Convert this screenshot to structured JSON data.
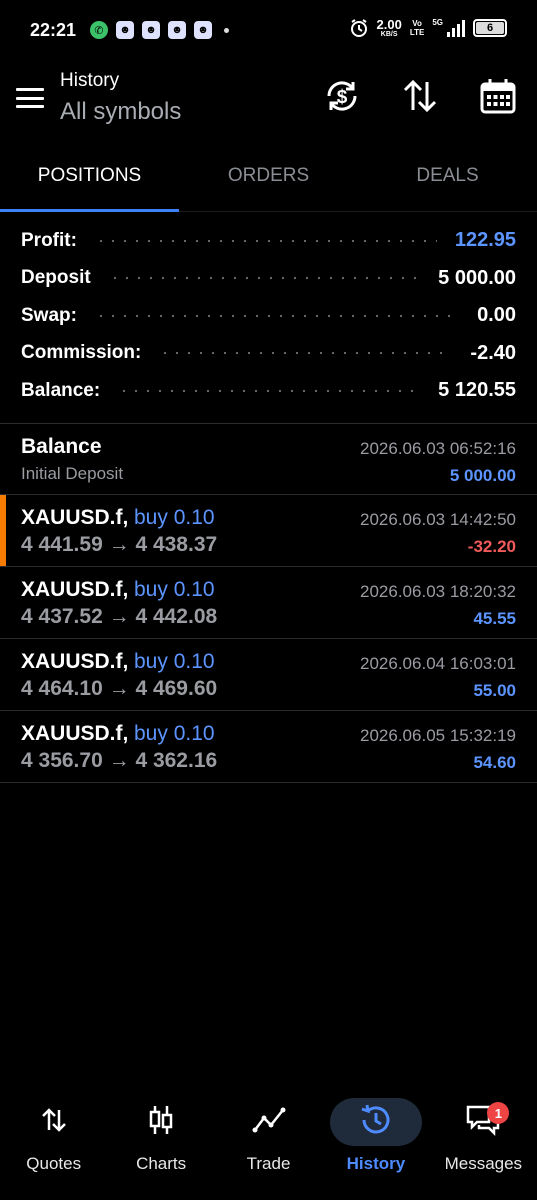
{
  "status_bar": {
    "time": "22:21",
    "speed_value": "2.00",
    "speed_unit": "KB/S",
    "network_label_top": "Vo",
    "network_label_bottom": "LTE",
    "network_type": "5G",
    "battery": "6",
    "apps": [
      "whatsapp-icon",
      "discord-icon",
      "discord-icon",
      "discord-icon",
      "discord-icon"
    ]
  },
  "header": {
    "title": "History",
    "subtitle": "All symbols",
    "icons": [
      "sync-currency-icon",
      "sort-icon",
      "calendar-icon"
    ]
  },
  "tabs": [
    {
      "label": "POSITIONS",
      "active": true
    },
    {
      "label": "ORDERS",
      "active": false
    },
    {
      "label": "DEALS",
      "active": false
    }
  ],
  "summary": [
    {
      "label": "Profit:",
      "value": "122.95",
      "highlight": true
    },
    {
      "label": "Deposit",
      "value": "5 000.00",
      "highlight": false
    },
    {
      "label": "Swap:",
      "value": "0.00",
      "highlight": false
    },
    {
      "label": "Commission:",
      "value": "-2.40",
      "highlight": false
    },
    {
      "label": "Balance:",
      "value": "5 120.55",
      "highlight": false
    }
  ],
  "balance_row": {
    "title": "Balance",
    "subtitle": "Initial Deposit",
    "date": "2026.06.03 06:52:16",
    "amount": "5 000.00"
  },
  "positions": [
    {
      "symbol": "XAUUSD.f,",
      "type": "buy 0.10",
      "open_price": "4 441.59",
      "arrow": "→",
      "close_price": "4 438.37",
      "date": "2026.06.03 14:42:50",
      "profit": "-32.20",
      "negative": true,
      "marked": true
    },
    {
      "symbol": "XAUUSD.f,",
      "type": "buy 0.10",
      "open_price": "4 437.52",
      "arrow": "→",
      "close_price": "4 442.08",
      "date": "2026.06.03 18:20:32",
      "profit": "45.55",
      "negative": false,
      "marked": false
    },
    {
      "symbol": "XAUUSD.f,",
      "type": "buy 0.10",
      "open_price": "4 464.10",
      "arrow": "→",
      "close_price": "4 469.60",
      "date": "2026.06.04 16:03:01",
      "profit": "55.00",
      "negative": false,
      "marked": false
    },
    {
      "symbol": "XAUUSD.f,",
      "type": "buy 0.10",
      "open_price": "4 356.70",
      "arrow": "→",
      "close_price": "4 362.16",
      "date": "2026.06.05 15:32:19",
      "profit": "54.60",
      "negative": false,
      "marked": false
    }
  ],
  "bottom_nav": [
    {
      "label": "Quotes",
      "icon": "quotes-arrows-icon",
      "active": false
    },
    {
      "label": "Charts",
      "icon": "candlestick-icon",
      "active": false
    },
    {
      "label": "Trade",
      "icon": "trade-line-icon",
      "active": false
    },
    {
      "label": "History",
      "icon": "history-clock-icon",
      "active": true
    },
    {
      "label": "Messages",
      "icon": "messages-icon",
      "active": false,
      "badge": "1"
    }
  ],
  "colors": {
    "background": "#000000",
    "accent": "#5c95ff",
    "negative": "#f25b5b",
    "marker": "#f57c00",
    "muted": "#9a9ca2"
  }
}
